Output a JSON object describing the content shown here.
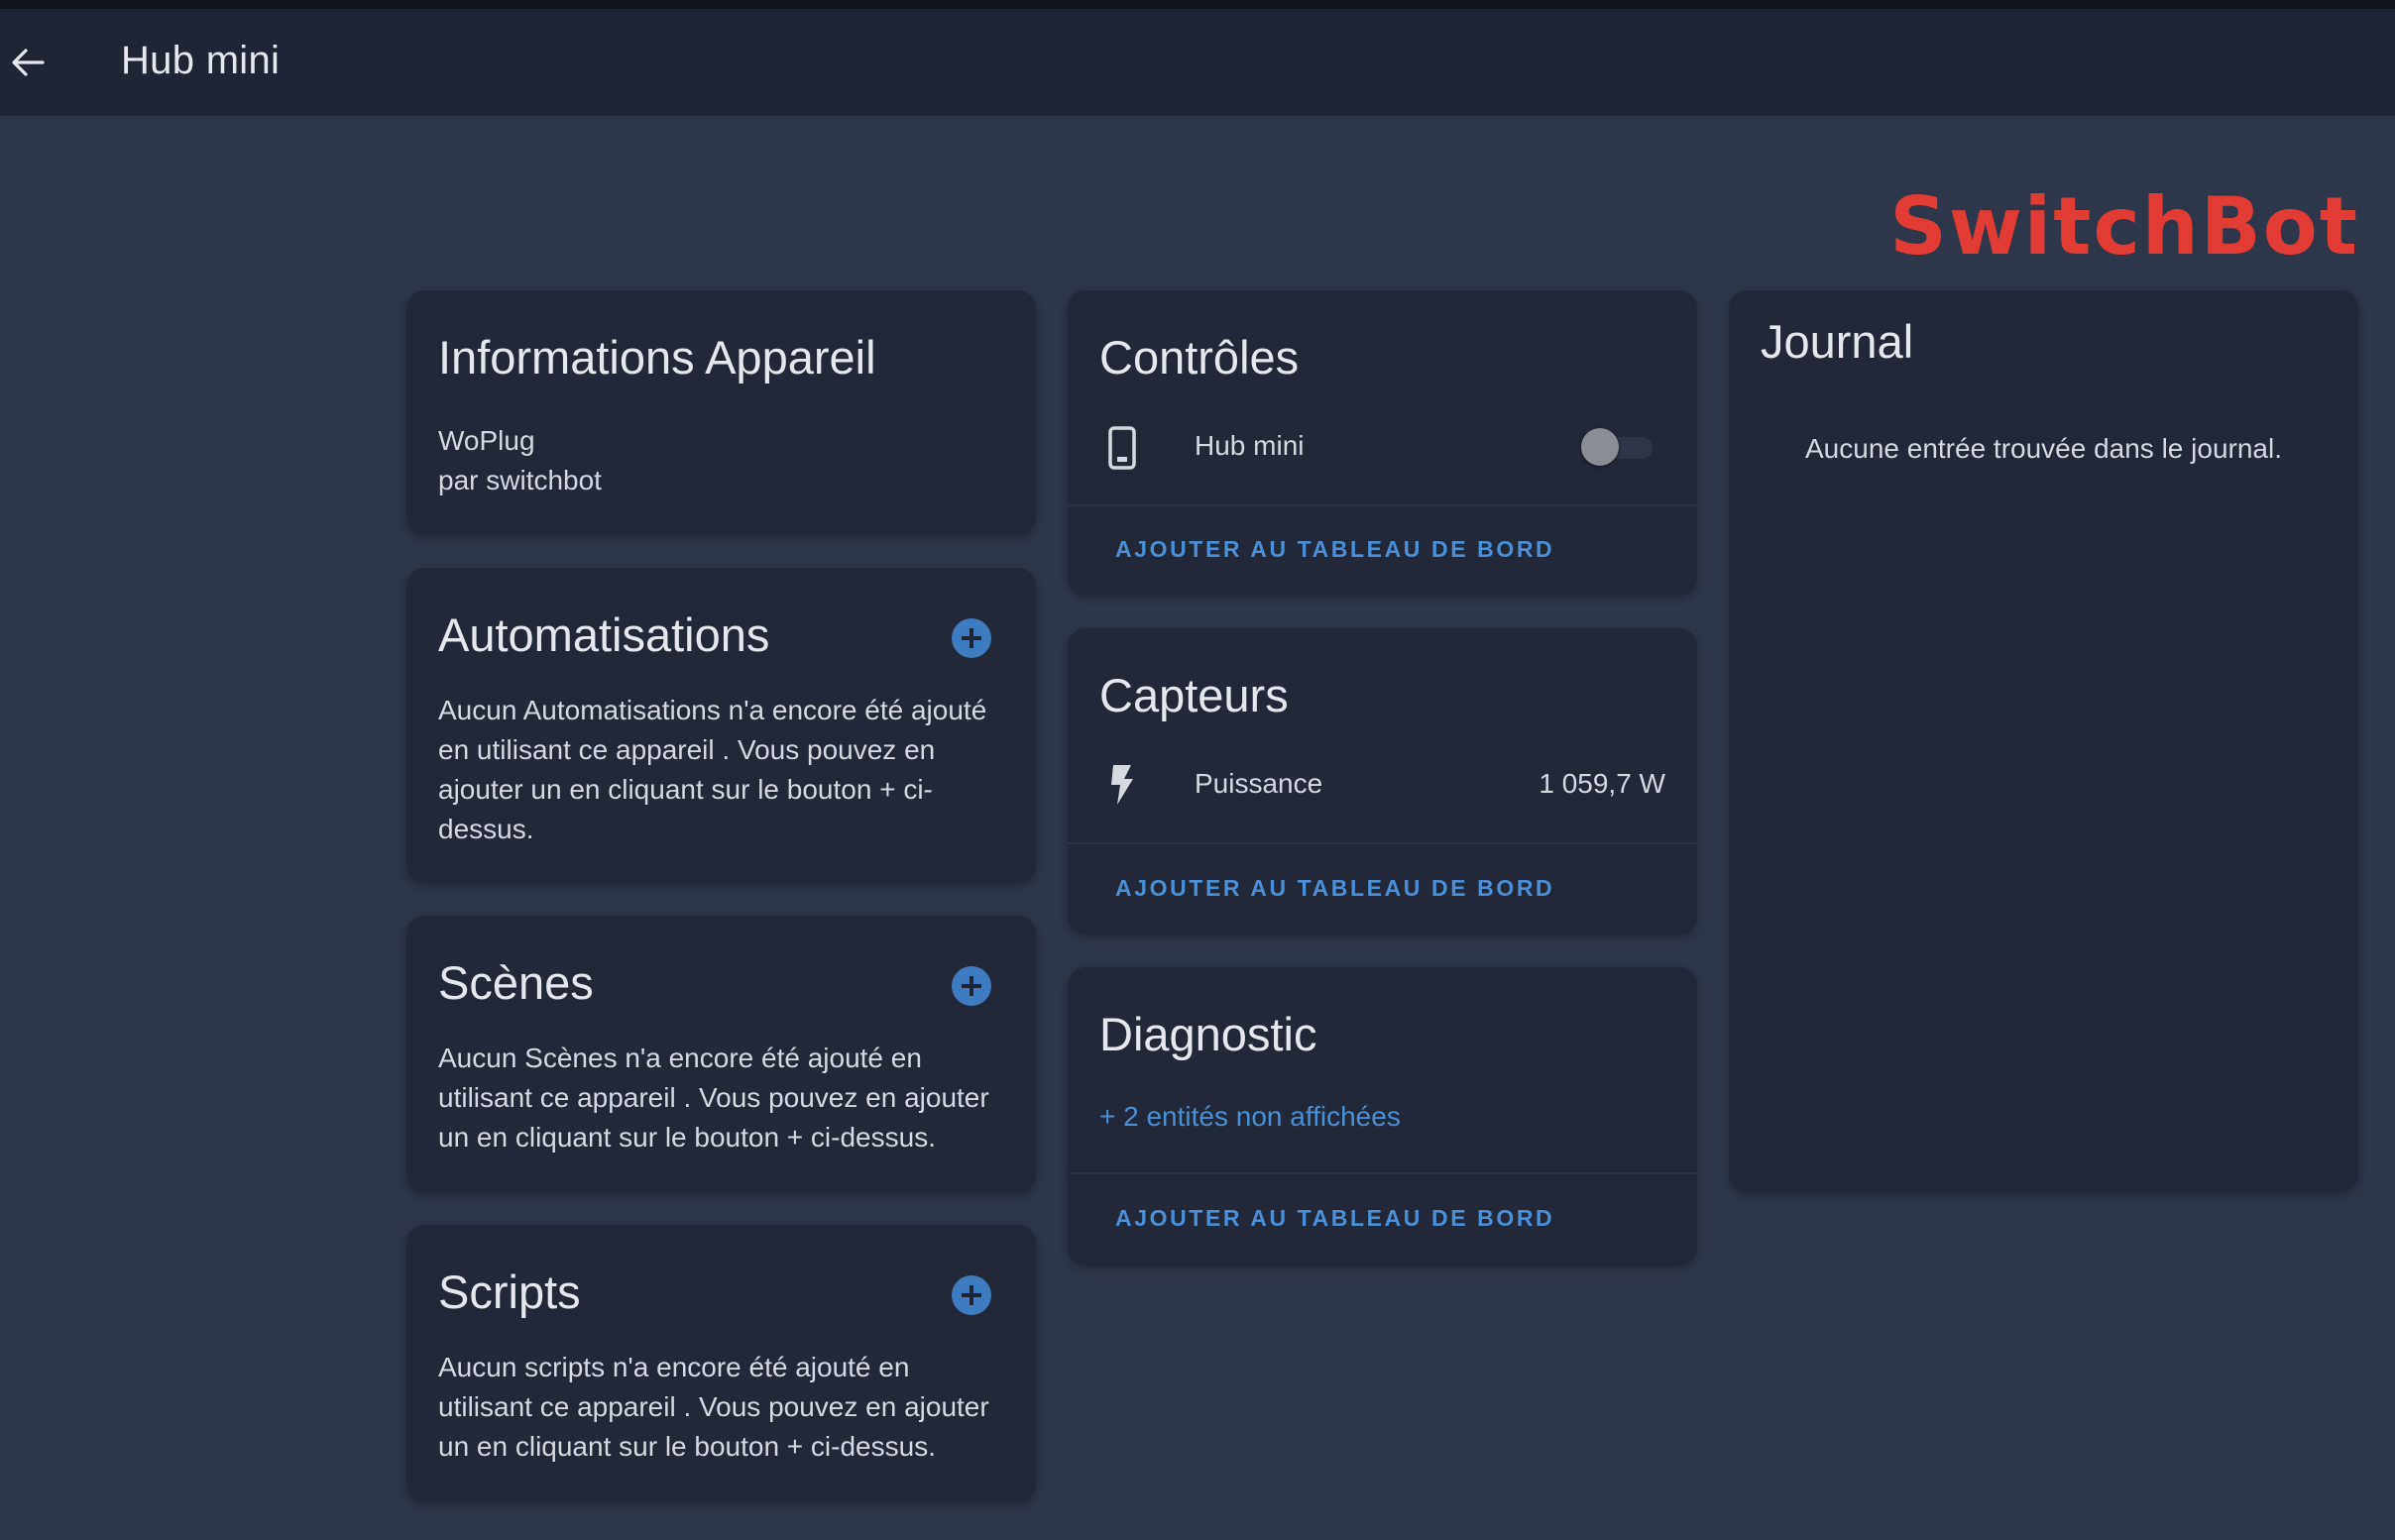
{
  "header": {
    "title": "Hub mini",
    "back_icon": "arrow-left-icon"
  },
  "brand": {
    "text": "SwitchBot",
    "color": "#e23b34"
  },
  "device_info": {
    "title": "Informations Appareil",
    "model": "WoPlug",
    "manufacturer": "par switchbot"
  },
  "automations": {
    "title": "Automatisations",
    "text": "Aucun Automatisations n'a encore été ajouté en utilisant ce appareil . Vous pouvez en ajouter un en cliquant sur le bouton + ci-dessus."
  },
  "scenes": {
    "title": "Scènes",
    "text": "Aucun Scènes n'a encore été ajouté en utilisant ce appareil . Vous pouvez en ajouter un en cliquant sur le bouton + ci-dessus."
  },
  "scripts": {
    "title": "Scripts",
    "text": "Aucun scripts n'a encore été ajouté en utilisant ce appareil . Vous pouvez en ajouter un en cliquant sur le bouton + ci-dessus."
  },
  "controls": {
    "title": "Contrôles",
    "entity_label": "Hub mini",
    "entity_icon": "phone-icon",
    "toggle_state": "off",
    "action": "AJOUTER AU TABLEAU DE BORD"
  },
  "sensors": {
    "title": "Capteurs",
    "entity_label": "Puissance",
    "entity_icon": "flash-icon",
    "value": "1 059,7 W",
    "action": "AJOUTER AU TABLEAU DE BORD"
  },
  "diagnostic": {
    "title": "Diagnostic",
    "hidden_entities": "+ 2 entités non affichées",
    "action": "AJOUTER AU TABLEAU DE BORD"
  },
  "logbook": {
    "title": "Journal",
    "empty_text": "Aucune entrée trouvée dans le journal."
  },
  "colors": {
    "background": "#2e3649",
    "card": "#222838",
    "header": "#1f2535",
    "accent": "#4a8fd8"
  }
}
